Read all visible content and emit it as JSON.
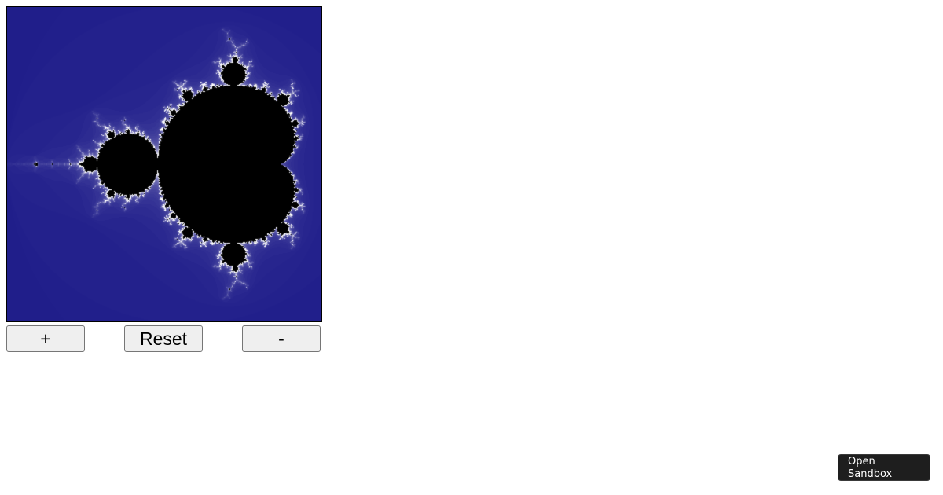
{
  "viewer": {
    "canvas_icon": "mandelbrot-set-fractal",
    "colors": {
      "outside": "#1f1d8a",
      "inside": "#000000",
      "edge": "#ffffff"
    },
    "region": {
      "re_min": -2.0,
      "re_max": 0.6,
      "im_min": -1.3,
      "im_max": 1.3
    }
  },
  "controls": {
    "zoom_in_label": "+",
    "reset_label": "Reset",
    "zoom_out_label": "-"
  },
  "sandbox": {
    "open_label": "Open Sandbox"
  }
}
